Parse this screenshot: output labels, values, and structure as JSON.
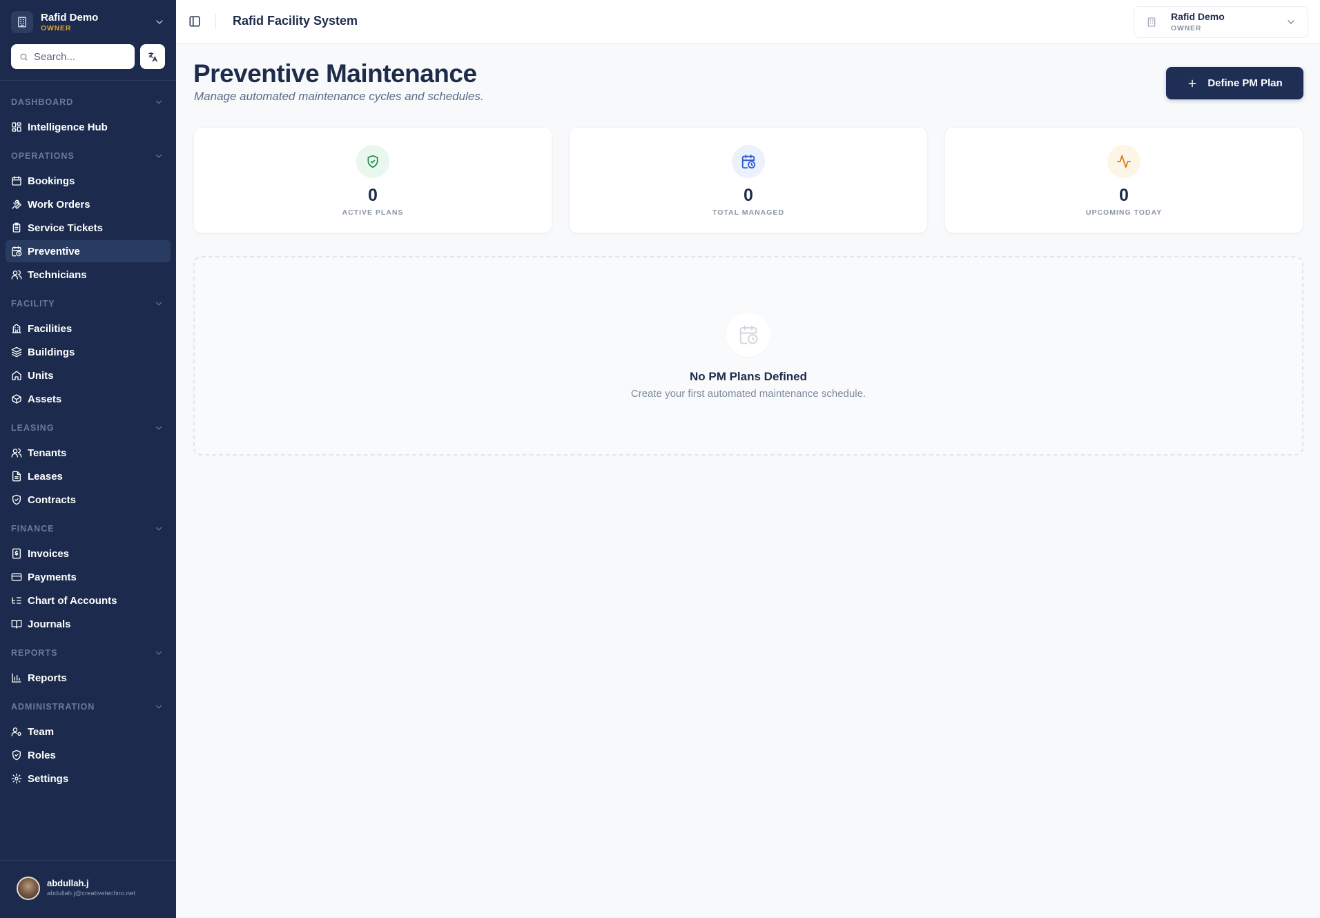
{
  "org": {
    "name": "Rafid Demo",
    "role": "OWNER"
  },
  "search": {
    "placeholder": "Search..."
  },
  "nav": {
    "dashboard": {
      "label": "DASHBOARD",
      "items": [
        "Intelligence Hub"
      ]
    },
    "operations": {
      "label": "OPERATIONS",
      "items": [
        "Bookings",
        "Work Orders",
        "Service Tickets",
        "Preventive",
        "Technicians"
      ]
    },
    "facility": {
      "label": "FACILITY",
      "items": [
        "Facilities",
        "Buildings",
        "Units",
        "Assets"
      ]
    },
    "leasing": {
      "label": "LEASING",
      "items": [
        "Tenants",
        "Leases",
        "Contracts"
      ]
    },
    "finance": {
      "label": "FINANCE",
      "items": [
        "Invoices",
        "Payments",
        "Chart of Accounts",
        "Journals"
      ]
    },
    "reports": {
      "label": "REPORTS",
      "items": [
        "Reports"
      ]
    },
    "administration": {
      "label": "ADMINISTRATION",
      "items": [
        "Team",
        "Roles",
        "Settings"
      ]
    },
    "active_item": "Preventive"
  },
  "user": {
    "name": "abdullah.j",
    "email": "abdullah.j@creativetechno.net"
  },
  "topbar": {
    "title": "Rafid Facility System",
    "account_name": "Rafid Demo",
    "account_role": "OWNER"
  },
  "page": {
    "title": "Preventive Maintenance",
    "subtitle": "Manage automated maintenance cycles and schedules.",
    "primary_button": "Define PM Plan"
  },
  "stats": [
    {
      "value": "0",
      "label": "ACTIVE PLANS",
      "icon": "shield-check-icon",
      "color": "#1f8a4c",
      "bg": "#e9f7ef"
    },
    {
      "value": "0",
      "label": "TOTAL MANAGED",
      "icon": "calendar-clock-icon",
      "color": "#2f5bd3",
      "bg": "#ebf1fd"
    },
    {
      "value": "0",
      "label": "UPCOMING TODAY",
      "icon": "activity-icon",
      "color": "#d97a12",
      "bg": "#fdf5e6"
    }
  ],
  "empty_state": {
    "title": "No PM Plans Defined",
    "subtitle": "Create your first automated maintenance schedule.",
    "icon": "calendar-clock-icon"
  },
  "colors": {
    "sidebar": "#1c2b4d",
    "accent": "#1e2e55",
    "role_gold": "#e5a32c"
  }
}
